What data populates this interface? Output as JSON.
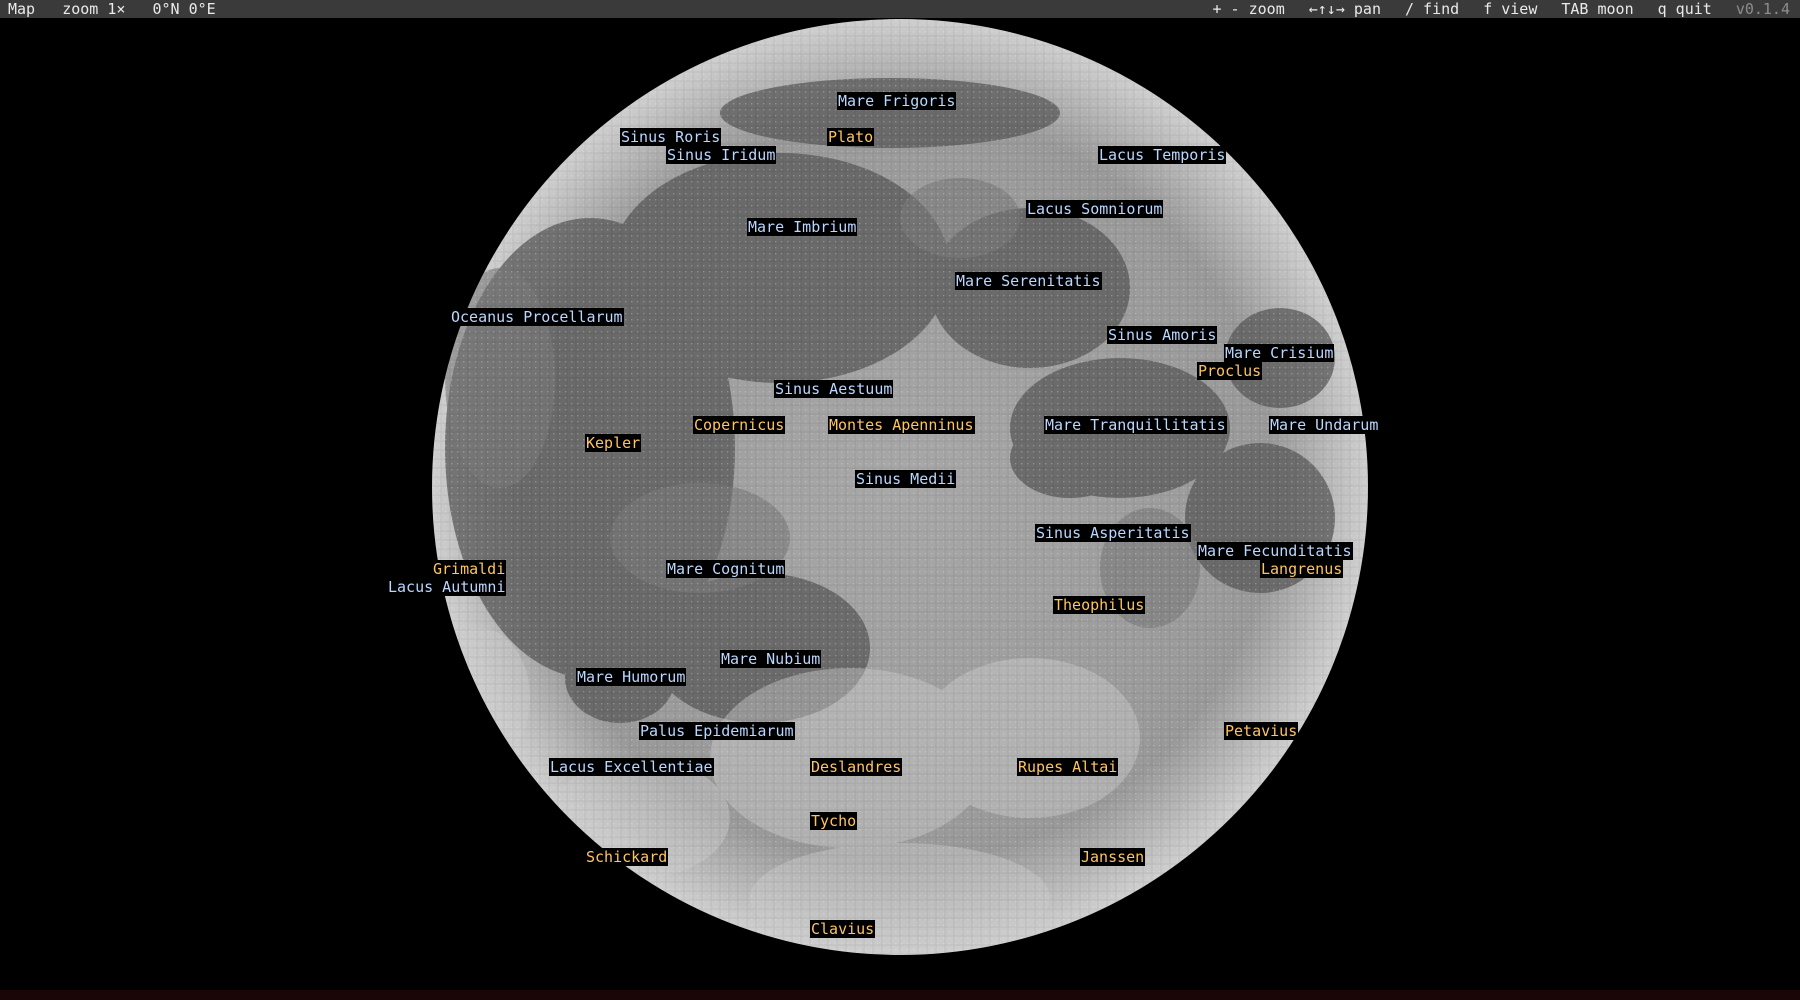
{
  "status_bar": {
    "mode": "Map",
    "zoom": "zoom 1×",
    "coords": "0°N 0°E",
    "hints": [
      "+ - zoom",
      "←↑↓→ pan",
      "/ find",
      "f view",
      "TAB moon",
      "q quit"
    ],
    "version": "v0.1.4"
  },
  "colors": {
    "mare_label": "#b9d7ff",
    "crater_label": "#ffc460",
    "status_bar_bg": "#3a3a3a"
  },
  "labels": [
    {
      "text": "Mare Frigoris",
      "kind": "mare"
    },
    {
      "text": "Sinus Roris",
      "kind": "mare"
    },
    {
      "text": "Plato",
      "kind": "crater"
    },
    {
      "text": "Sinus Iridum",
      "kind": "mare"
    },
    {
      "text": "Lacus Temporis",
      "kind": "mare"
    },
    {
      "text": "Lacus Somniorum",
      "kind": "mare"
    },
    {
      "text": "Mare Imbrium",
      "kind": "mare"
    },
    {
      "text": "Mare Serenitatis",
      "kind": "mare"
    },
    {
      "text": "Oceanus Procellarum",
      "kind": "mare"
    },
    {
      "text": "Sinus Amoris",
      "kind": "mare"
    },
    {
      "text": "Mare Crisium",
      "kind": "mare"
    },
    {
      "text": "Proclus",
      "kind": "crater"
    },
    {
      "text": "Sinus Aestuum",
      "kind": "mare"
    },
    {
      "text": "Copernicus",
      "kind": "crater"
    },
    {
      "text": "Montes Apenninus",
      "kind": "crater"
    },
    {
      "text": "Mare Tranquillitatis",
      "kind": "mare"
    },
    {
      "text": "Mare Undarum",
      "kind": "mare"
    },
    {
      "text": "Kepler",
      "kind": "crater"
    },
    {
      "text": "Sinus Medii",
      "kind": "mare"
    },
    {
      "text": "Sinus Asperitatis",
      "kind": "mare"
    },
    {
      "text": "Mare Fecunditatis",
      "kind": "mare"
    },
    {
      "text": "Grimaldi",
      "kind": "crater"
    },
    {
      "text": "Mare Cognitum",
      "kind": "mare"
    },
    {
      "text": "Langrenus",
      "kind": "crater"
    },
    {
      "text": "Lacus Autumni",
      "kind": "mare"
    },
    {
      "text": "Theophilus",
      "kind": "crater"
    },
    {
      "text": "Mare Nubium",
      "kind": "mare"
    },
    {
      "text": "Mare Humorum",
      "kind": "mare"
    },
    {
      "text": "Palus Epidemiarum",
      "kind": "mare"
    },
    {
      "text": "Petavius",
      "kind": "crater"
    },
    {
      "text": "Lacus Excellentiae",
      "kind": "mare"
    },
    {
      "text": "Deslandres",
      "kind": "crater"
    },
    {
      "text": "Rupes Altai",
      "kind": "crater"
    },
    {
      "text": "Tycho",
      "kind": "crater"
    },
    {
      "text": "Schickard",
      "kind": "crater"
    },
    {
      "text": "Janssen",
      "kind": "crater"
    },
    {
      "text": "Clavius",
      "kind": "crater"
    }
  ]
}
